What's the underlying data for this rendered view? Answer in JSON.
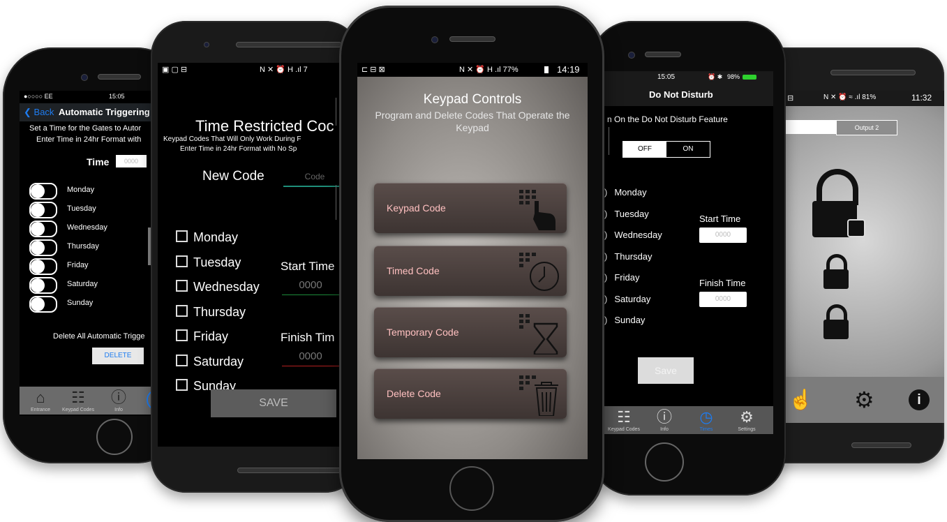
{
  "phone1": {
    "status": {
      "carrier": "●○○○○ EE",
      "time": "15:05"
    },
    "nav": {
      "back": "Back",
      "title": "Automatic Triggering T"
    },
    "desc1": "Set a Time for the Gates to Autor",
    "desc2": "Enter Time in 24hr Format with",
    "time_label": "Time",
    "time_placeholder": "0000",
    "days": [
      "Monday",
      "Tuesday",
      "Wednesday",
      "Thursday",
      "Friday",
      "Saturday",
      "Sunday"
    ],
    "delete_text": "Delete All Automatic Trigge",
    "delete_button": "DELETE",
    "tabs": [
      "Entrance",
      "Keypad Codes",
      "Info"
    ]
  },
  "phone2": {
    "status": {
      "right": "N ✕ ⏰ H .ıl 7"
    },
    "title": "Time Restricted Coc",
    "sub1": "Keypad Codes That Will Only Work During F",
    "sub2": "Enter Time in 24hr Format with No Sp",
    "new_code": "New Code",
    "code_placeholder": "Code",
    "days": [
      "Monday",
      "Tuesday",
      "Wednesday",
      "Thursday",
      "Friday",
      "Saturday",
      "Sunday"
    ],
    "start_label": "Start Time",
    "start_value": "0000",
    "finish_label": "Finish Tim",
    "finish_value": "0000",
    "save": "SAVE"
  },
  "phone3": {
    "status": {
      "right": "N ✕ ⏰ H .ıl 77%",
      "time": "14:19"
    },
    "title": "Keypad Controls",
    "subtitle": "Program and Delete Codes That Operate the Keypad",
    "buttons": [
      {
        "label": "Keypad Code",
        "icon": "keypad-hand-icon"
      },
      {
        "label": "Timed Code",
        "icon": "keypad-clock-icon"
      },
      {
        "label": "Temporary Code",
        "icon": "keypad-hourglass-icon"
      },
      {
        "label": "Delete Code",
        "icon": "keypad-trash-icon"
      }
    ]
  },
  "phone4": {
    "status": {
      "time": "15:05",
      "battery": "98%"
    },
    "title": "Do Not Disturb",
    "feature": "n On the Do Not Disturb Feature",
    "off": "OFF",
    "on": "ON",
    "days": [
      "Monday",
      "Tuesday",
      "Wednesday",
      "Thursday",
      "Friday",
      "Saturday",
      "Sunday"
    ],
    "start_label": "Start Time",
    "start_value": "0000",
    "finish_label": "Finish Time",
    "finish_value": "0000",
    "save": "Save",
    "tabs": [
      "Keypad Codes",
      "Info",
      "Times",
      "Settings"
    ]
  },
  "phone5": {
    "status": {
      "right": "N ✕ ⏰ ≈ .ıl 81%",
      "time": "11:32"
    },
    "output2": "Output 2"
  },
  "colors": {
    "accent_blue": "#1e7cf0",
    "button_red_text": "#ffc0c0"
  }
}
